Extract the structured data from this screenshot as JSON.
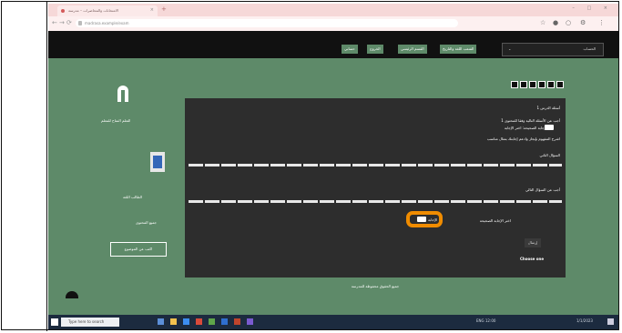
{
  "browser": {
    "tab_title": "الامتحانات والمحاضرات – مدرسة",
    "tab_close": "×",
    "new_tab": "+",
    "window_controls": "– □ ×",
    "address": "madrasa.example/exam",
    "nav_back": "←",
    "nav_forward": "→",
    "nav_reload": "⟳",
    "ext_icons": [
      "☆",
      "●",
      "○",
      "⚙",
      "⋮"
    ]
  },
  "header": {
    "buttons": [
      "حسابي",
      "الخروج",
      "القسم الرئيسي",
      "الشعب اللغة والتاريخ"
    ],
    "dropdown_label": "الحساب"
  },
  "sidebar": {
    "title": "التعلم المتاح للمعلم",
    "section2": "الطالب اللغة",
    "links": "جميع المحتوى",
    "button": "اكتب عن الموضوع"
  },
  "panel": {
    "heading": "أسئلة الدرس 1",
    "lines": [
      "أجب عن الأسئلة التالية وفقا للمحتوى 1",
      "الإجابة الصحيحة: اختر الإجابة",
      "اشرح المفهوم بإيجاز وادعم إجابتك بمثال مناسب",
      "السؤال الثاني",
      "أجب عن السؤال التالي",
      "اختر الإجابة الصحيحة"
    ],
    "option_label": "الإجابة",
    "submit": "إرسال",
    "english": "Choose one"
  },
  "footer": "جميع الحقوق محفوظة للمدرسة",
  "taskbar": {
    "search": "Type here to search",
    "tray": "ENG 12:00",
    "date": "1/1/2023"
  },
  "colors": {
    "accent": "#5e8a69",
    "panel": "#2d2d2d",
    "highlight": "#f08c00"
  }
}
